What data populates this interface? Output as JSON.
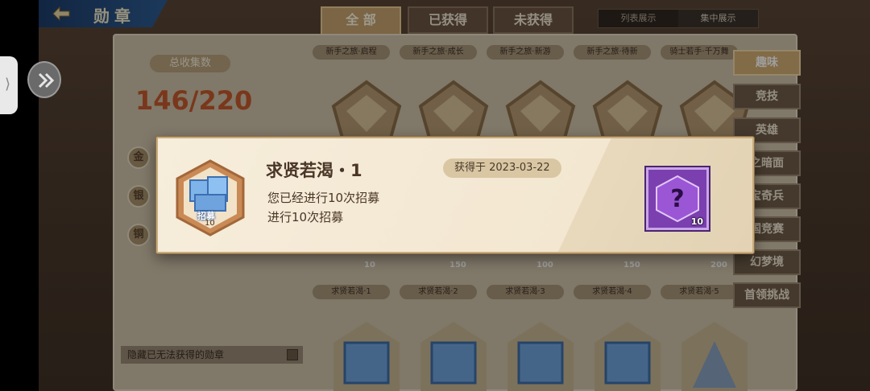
{
  "header": {
    "title": "勋章"
  },
  "tabs": [
    {
      "label": "全 部"
    },
    {
      "label": "已获得"
    },
    {
      "label": "未获得"
    }
  ],
  "view_switch": {
    "list_label": "列表展示",
    "focus_label": "集中展示"
  },
  "summary": {
    "label": "总收集数",
    "value": "146/220",
    "grades": [
      "金",
      "银",
      "铜"
    ],
    "hide_label": "隐藏已无法获得的勋章"
  },
  "categories": [
    {
      "label": "趣味"
    },
    {
      "label": "竞技"
    },
    {
      "label": "英雄"
    },
    {
      "label": "之暗面"
    },
    {
      "label": "宝奇兵"
    },
    {
      "label": "国竞赛"
    },
    {
      "label": "幻梦境"
    },
    {
      "label": "首领挑战"
    }
  ],
  "top_row_captions": [
    "新手之旅·启程",
    "新手之旅·成长",
    "新手之旅·新游",
    "新手之旅·待新",
    "骑士若手·千万舞"
  ],
  "mid_row": {
    "captions": [
      "求贤若渴·1",
      "求贤若渴·2",
      "求贤若渴·3",
      "求贤若渴·4",
      "求贤若渴·5"
    ],
    "counts": [
      "10",
      "150",
      "100",
      "150",
      "200"
    ]
  },
  "popup": {
    "medal_text": "招募",
    "medal_count": "10",
    "name": "求贤若渴・1",
    "date": "获得于 2023-03-22",
    "desc_line1": "您已经进行10次招募",
    "desc_line2": "进行10次招募",
    "reward_count": "10"
  },
  "colors": {
    "accent_gold": "#c7a36e",
    "value_orange": "#c65a2c",
    "reward_purple": "#7b3fb0"
  }
}
